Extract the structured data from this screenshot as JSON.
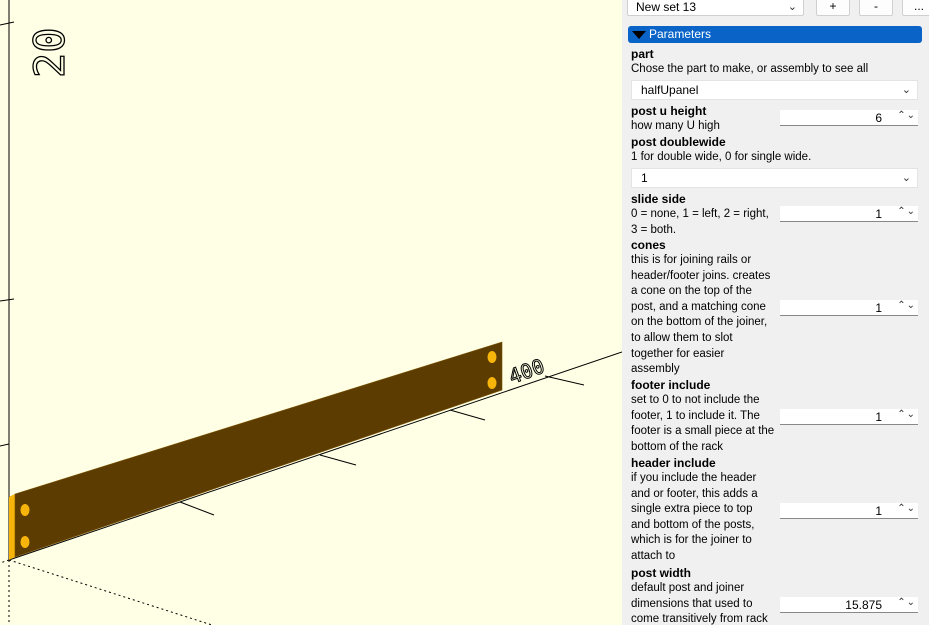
{
  "viewport": {
    "axis_labels": {
      "vertical": "20",
      "horizontal": "400"
    },
    "colors": {
      "background": "#ffffe5",
      "part_top": "#f7b40a",
      "part_face": "#5c3c00",
      "axis": "#000000"
    }
  },
  "toolbar": {
    "preset": "New set 13",
    "add_label": "+",
    "remove_label": "-",
    "more_label": "..."
  },
  "section": {
    "title": "Parameters"
  },
  "params": {
    "part": {
      "name": "part",
      "desc": "Chose the part to make, or assembly to see all",
      "value": "halfUpanel"
    },
    "post_u_height": {
      "name": "post u height",
      "desc": "how many U high",
      "value": "6"
    },
    "post_doublewide": {
      "name": "post doublewide",
      "desc": "1 for double wide, 0 for single wide.",
      "value": "1"
    },
    "slide_side": {
      "name": "slide side",
      "desc": [
        "0 = none, 1 = left, 2 = right,",
        "3 = both."
      ],
      "value": "1"
    },
    "cones": {
      "name": "cones",
      "desc": [
        "this is for joining rails or",
        "header/footer joins. creates",
        "a cone on the top of the",
        "post, and a matching cone",
        "on the bottom of the joiner,",
        "to allow them to slot",
        "together for easier",
        "assembly"
      ],
      "value": "1"
    },
    "footer_include": {
      "name": "footer include",
      "desc": [
        "set to 0 to not include the",
        "footer, 1 to include it. The",
        "footer is a small piece at the",
        "bottom of the rack"
      ],
      "value": "1"
    },
    "header_include": {
      "name": "header include",
      "desc": [
        "if you include the header",
        "and or footer, this adds a",
        "single extra piece to top",
        "and bottom of the posts,",
        "which is for the joiner to",
        "attach to"
      ],
      "value": "1"
    },
    "post_width": {
      "name": "post width",
      "desc": [
        "default post and joiner",
        "dimensions that used to",
        "come transitively from rack"
      ],
      "value": "15.875"
    }
  }
}
